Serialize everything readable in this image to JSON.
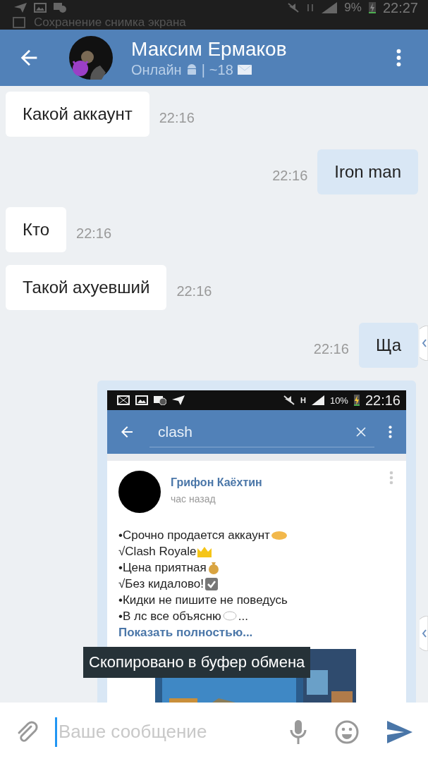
{
  "status_bar": {
    "battery": "9%",
    "time": "22:27"
  },
  "notification": {
    "text": "Сохранение снимка экрана"
  },
  "header": {
    "title": "Максим Ермаков",
    "status": "Онлайн",
    "separator": "|",
    "count": "~18"
  },
  "messages": [
    {
      "kind": "text",
      "outgoing": false,
      "text": "Какой аккаунт",
      "time": "22:16"
    },
    {
      "kind": "text",
      "outgoing": true,
      "text": "Iron man",
      "time": "22:16"
    },
    {
      "kind": "text",
      "outgoing": false,
      "text": "Кто",
      "time": "22:16"
    },
    {
      "kind": "text",
      "outgoing": false,
      "text": "Такой ахуевший",
      "time": "22:16"
    },
    {
      "kind": "text",
      "outgoing": true,
      "text": "Ща",
      "time": "22:16"
    },
    {
      "kind": "screenshot",
      "outgoing": true,
      "screenshot": {
        "status_bar": {
          "network": "H",
          "battery": "10%",
          "time": "22:16"
        },
        "search": {
          "value": "clash"
        },
        "post": {
          "author": "Грифон Каёхтин",
          "time": "час назад",
          "lines": [
            {
              "text": "•Срочно продается аккаунт"
            },
            {
              "text": " √Clash Royale"
            },
            {
              "text": "•Цена приятная"
            },
            {
              "text": "√Без кидалово!"
            },
            {
              "text": "•Кидки не пишите не поведусь"
            },
            {
              "text": "•В лс все объясню",
              "tail": "..."
            }
          ],
          "more": "Показать полностью..."
        }
      }
    }
  ],
  "toast": {
    "text": "Скопировано в буфер обмена"
  },
  "composer": {
    "placeholder": "Ваше сообщение"
  }
}
